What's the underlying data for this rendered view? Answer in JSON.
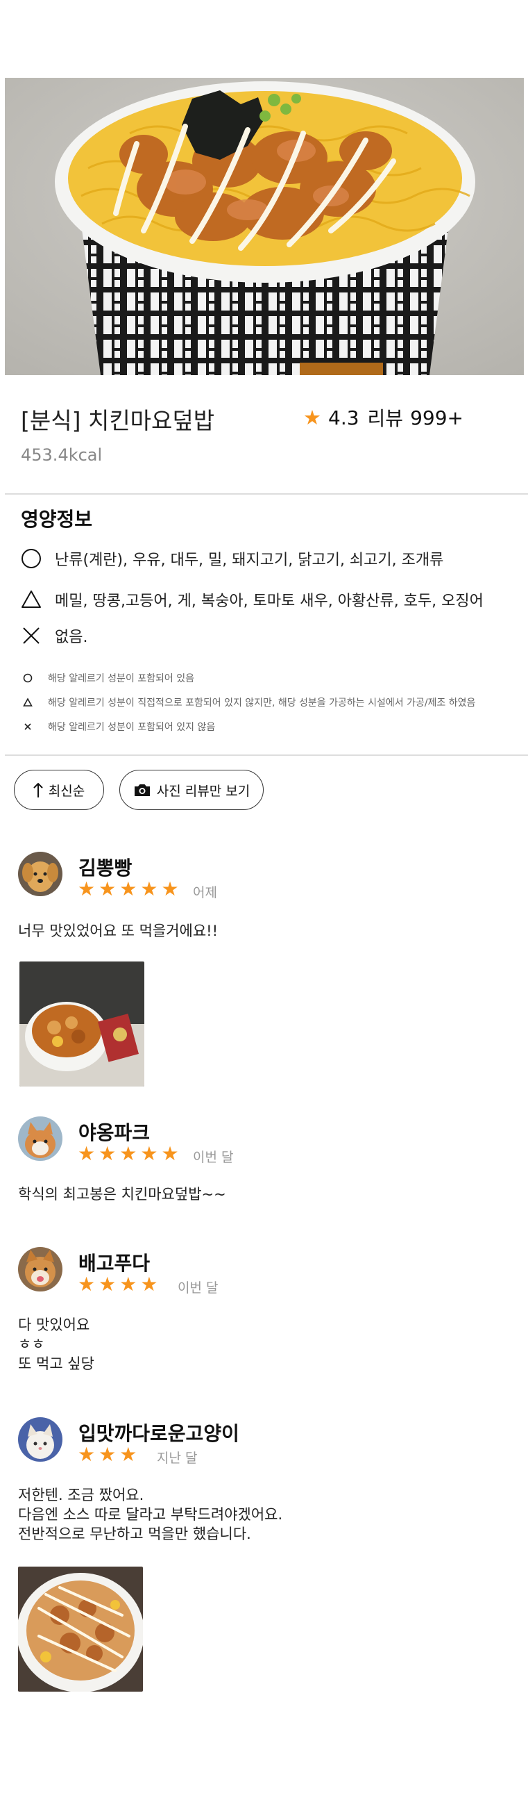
{
  "product": {
    "name": "[분식] 치킨마요덮밥",
    "rating": "4.3",
    "review_label": "리뷰",
    "review_count": "999+",
    "kcal": "453.4kcal"
  },
  "nutrition": {
    "title": "영양정보",
    "contains": "난류(계란), 우유, 대두, 밀, 돼지고기, 닭고기, 쇠고기, 조개류",
    "cross_contact": "메밀, 땅콩,고등어, 게, 복숭아, 토마토 새우, 아황산류, 호두, 오징어",
    "none": "없음.",
    "legend": {
      "circle": "해당 알레르기 성분이 포함되어 있음",
      "triangle": "해당 알레르기 성분이 직접적으로 포함되어 있지 않지만, 해당 성분을 가공하는 시설에서 가공/제조 하였음",
      "cross": "해당 알레르기 성분이 포함되어 있지 않음"
    }
  },
  "filters": {
    "sort_label": "최신순",
    "photo_only_label": "사진 리뷰만 보기"
  },
  "reviews": [
    {
      "name": "김뽕빵",
      "stars": 5,
      "date": "어제",
      "lines": [
        "너무 맛있었어요 또 먹을거에요!!"
      ],
      "has_photo": true
    },
    {
      "name": "야옹파크",
      "stars": 5,
      "date": "이번 달",
      "lines": [
        "학식의 최고봉은 치킨마요덮밥~~"
      ],
      "has_photo": false
    },
    {
      "name": "배고푸다",
      "stars": 4,
      "date": "이번 달",
      "lines": [
        "다 맛있어요",
        "ㅎㅎ",
        "또 먹고 싶당"
      ],
      "has_photo": false
    },
    {
      "name": "입맛까다로운고양이",
      "stars": 3,
      "date": "지난 달",
      "lines": [
        "저한텐. 조금 짰어요.",
        "다음엔 소스 따로 달라고 부탁드려야겠어요.",
        "전반적으로 무난하고 먹을만 했습니다."
      ],
      "has_photo": true
    }
  ],
  "colors": {
    "star": "#f7941d",
    "date": "#999999",
    "divider": "#dddddd"
  },
  "icons": {
    "rating": "star-icon",
    "sort": "arrow-up-icon",
    "photo": "camera-icon"
  }
}
